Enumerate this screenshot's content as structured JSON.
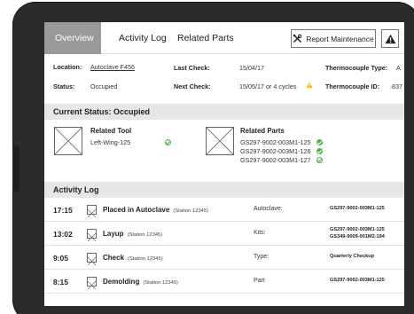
{
  "tabs": {
    "overview": "Overview",
    "activity_log": "Activity Log",
    "related_parts": "Related Parts"
  },
  "toolbar": {
    "report_label": "Report Maintenance",
    "report_icon": "tools-icon",
    "alert_icon": "warning-icon"
  },
  "info": {
    "location_label": "Location:",
    "location_value": "Autoclave F456",
    "status_label": "Status:",
    "status_value": "Occupied",
    "last_check_label": "Last Check:",
    "last_check_value": "15/04/17",
    "next_check_label": "Next Check:",
    "next_check_value": "15/05/17 or 4 cycles",
    "tc_type_label": "Thermocouple Type:",
    "tc_type_value": "A",
    "tc_id_label": "Thermocouple ID:",
    "tc_id_value": "837"
  },
  "current_status": {
    "heading": "Current Status: Occupied",
    "related_tool_title": "Related Tool",
    "related_tool_value": "Left-Wing-125",
    "related_parts_title": "Related Parts",
    "related_parts": [
      "GS297-9002-003M1-125",
      "GS297-9002-003M1-126",
      "GS297-9002-003M1-127"
    ]
  },
  "activity_log": {
    "heading": "Activity Log",
    "rows": [
      {
        "time": "17:15",
        "action": "Placed in Autoclave",
        "station": "(Station 12345)",
        "key": "Autoclave:",
        "value": "GS297-9002-003M1-125",
        "value2": ""
      },
      {
        "time": "13:02",
        "action": "Layup",
        "station": "(Station 12345)",
        "key": "Kits:",
        "value": "GS297-9002-003M1-125",
        "value2": "GS349-9009-001M2-194"
      },
      {
        "time": "9:05",
        "action": "Check",
        "station": "(Station 12345)",
        "key": "Type:",
        "value": "Quarterly Checkup",
        "value2": ""
      },
      {
        "time": "8:15",
        "action": "Demolding",
        "station": "(Station 12345)",
        "key": "Part",
        "value": "GS297-9002-003M1-125",
        "value2": ""
      }
    ]
  },
  "colors": {
    "active_tab": "#9a9a9a",
    "section_bg": "#e6e6e6",
    "ok_green": "#4caf50",
    "warn_yellow": "#f2c200"
  }
}
